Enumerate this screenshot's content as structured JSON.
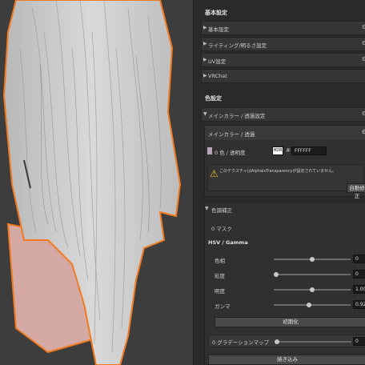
{
  "sections": {
    "basic": "基本設定",
    "color": "色設定"
  },
  "folds": [
    {
      "label": "基本設定"
    },
    {
      "label": "ライティング/明るさ設定"
    },
    {
      "label": "UV設定"
    },
    {
      "label": "VRChat"
    }
  ],
  "color_fold": {
    "label": "メインカラー / 透過設定"
  },
  "main_color": {
    "header": "メインカラー / 透過",
    "color_label": "0 色 / 透明度",
    "hdr_label": "HDR",
    "hex_value": "FFFFFF",
    "swatch_color": "#b9a3b7",
    "warning_text": "このテクスチャはAlphaIsTransparencyが設定されていません。",
    "auto_fix_label": "自動修正"
  },
  "color_correction": {
    "title": "色調補正",
    "mask_label": "0 マスク",
    "hsv_title": "HSV / Gamma",
    "rows": [
      {
        "label": "色相",
        "value": "0",
        "knob": 0.5
      },
      {
        "label": "彩度",
        "value": "0",
        "knob": 0.0
      },
      {
        "label": "明度",
        "value": "1.008",
        "knob": 0.5
      },
      {
        "label": "ガンマ",
        "value": "0.925",
        "knob": 0.45
      }
    ],
    "reset_label": "初期化",
    "gradation_label": "0 グラデーションマップ",
    "gradation_value": "0",
    "bake_label": "焼き込み"
  },
  "colors": {
    "accent_outline": "#f07a22",
    "hair": "#cfcfcf",
    "skin": "#d8aaa5"
  }
}
